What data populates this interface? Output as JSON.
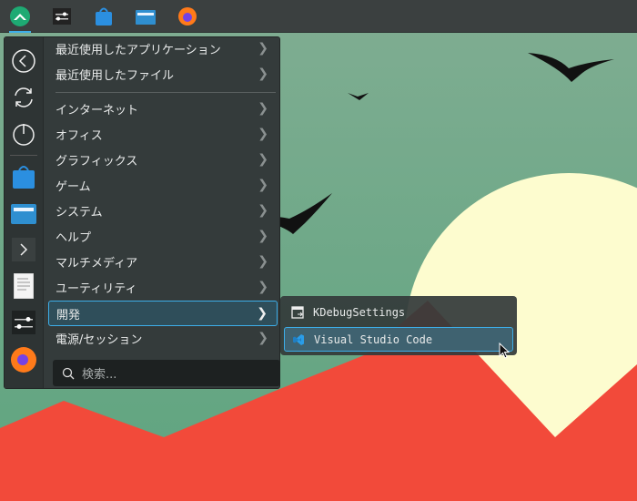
{
  "taskbar": {
    "items": [
      "application-launcher",
      "system-settings",
      "discover",
      "file-manager",
      "firefox"
    ]
  },
  "menu": {
    "sidebar": [
      "back",
      "refresh",
      "power",
      "discover",
      "files",
      "terminal",
      "text-editor",
      "settings",
      "firefox"
    ],
    "items": [
      {
        "label": "最近使用したアプリケーション"
      },
      {
        "label": "最近使用したファイル"
      },
      {
        "label": "インターネット"
      },
      {
        "label": "オフィス"
      },
      {
        "label": "グラフィックス"
      },
      {
        "label": "ゲーム"
      },
      {
        "label": "システム"
      },
      {
        "label": "ヘルプ"
      },
      {
        "label": "マルチメディア"
      },
      {
        "label": "ユーティリティ"
      },
      {
        "label": "開発"
      },
      {
        "label": "電源/セッション"
      }
    ],
    "search_placeholder": "検索..."
  },
  "submenu": {
    "items": [
      {
        "label": "KDebugSettings"
      },
      {
        "label": "Visual Studio Code"
      }
    ]
  },
  "colors": {
    "accent": "#3daee9",
    "sun": "#fdfccf",
    "mountain": "#f24a3a"
  }
}
